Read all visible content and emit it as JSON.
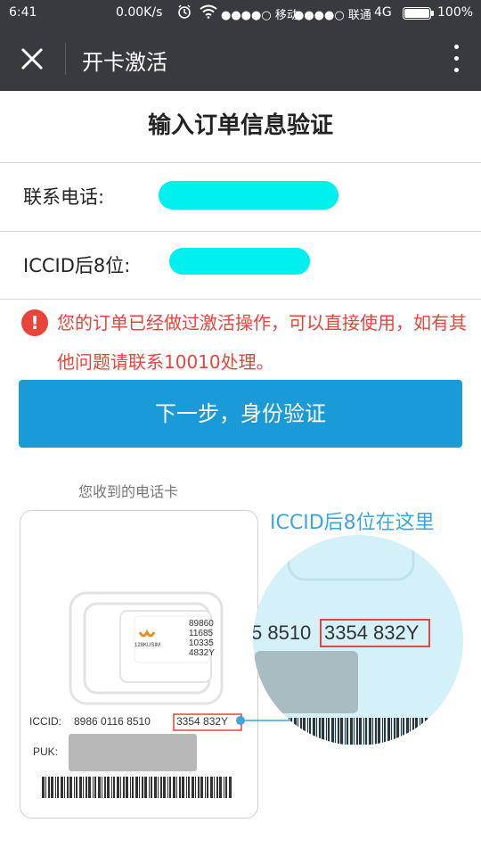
{
  "status_bar": {
    "time": "6:41",
    "speed": "0.00K/s",
    "carrier1": "●●●●○ 移动",
    "carrier2": "●●●●○ 联通",
    "network": "4G",
    "battery": "100%"
  },
  "top_bar": {
    "title": "开卡激活",
    "close_icon": "close-icon",
    "more_icon": "more-vertical-icon"
  },
  "page": {
    "heading": "输入订单信息验证",
    "phone_label": "联系电话:",
    "iccid_label": "ICCID后8位:",
    "alert_text": "您的订单已经做过激活操作，可以直接使用，如有其他问题请联系10010处理。",
    "next_button": "下一步，身份验证"
  },
  "illustration": {
    "caption": "您收到的电话卡",
    "zoom_label": "ICCID后8位在这里",
    "iccid_label": "ICCID:",
    "iccid_prefix": "8986 0116 8510",
    "iccid_suffix": "3354 832Y",
    "puk_label": "PUK:",
    "zoom_prefix": "5  8510",
    "zoom_suffix": "3354  832Y",
    "chip_lines": [
      "89860",
      "11685",
      "10335",
      "4832Y"
    ],
    "chip_brand": "128KUSIM",
    "accent_color": "#3aa6dd",
    "highlight_color": "#e8443b"
  }
}
